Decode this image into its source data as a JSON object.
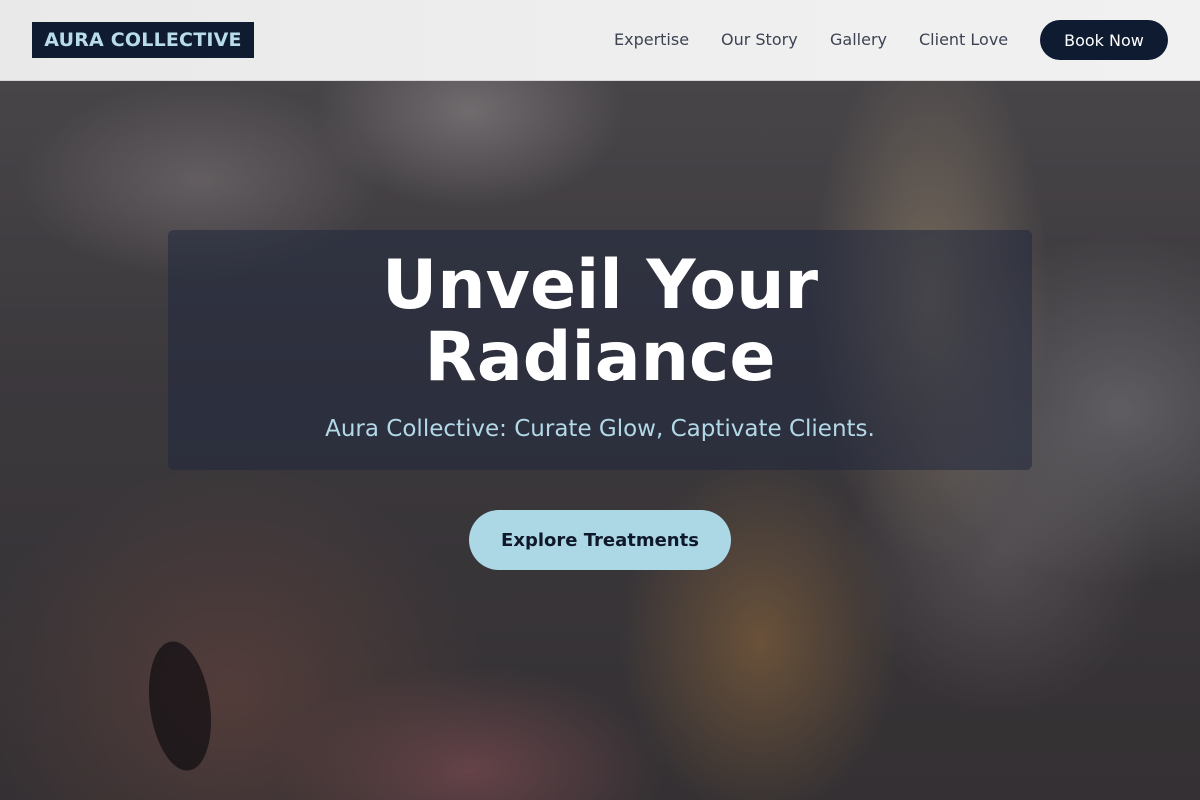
{
  "header": {
    "logo": "AURA COLLECTIVE",
    "nav": [
      {
        "label": "Expertise"
      },
      {
        "label": "Our Story"
      },
      {
        "label": "Gallery"
      },
      {
        "label": "Client Love"
      }
    ],
    "cta_label": "Book Now"
  },
  "hero": {
    "title_line1": "Unveil Your",
    "title_line2": "Radiance",
    "subtitle": "Aura Collective: Curate Glow, Captivate Clients.",
    "button_label": "Explore Treatments"
  },
  "colors": {
    "navy": "#0f1b30",
    "accent_light_blue": "#acd8e6",
    "subtitle_blue": "#b3d9e8",
    "header_bg": "#efefef"
  }
}
